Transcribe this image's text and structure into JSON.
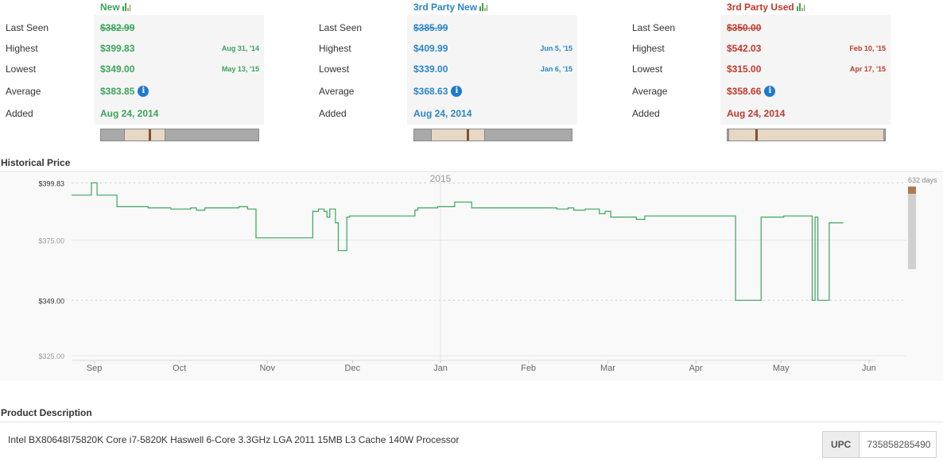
{
  "columns": [
    {
      "key": "new",
      "title": "New",
      "color": "#3aa55a",
      "labels": [
        "Last Seen",
        "Highest",
        "Lowest",
        "Average",
        "Added"
      ],
      "last_seen": "$382.99",
      "highest": "$399.83",
      "highest_date": "Aug 31, '14",
      "lowest": "$349.00",
      "lowest_date": "May 13, '15",
      "average": "$383.85",
      "added": "Aug 24, 2014"
    },
    {
      "key": "third_party_new",
      "title": "3rd Party New",
      "color": "#2c86c6",
      "labels": [
        "Last Seen",
        "Highest",
        "Lowest",
        "Average",
        "Added"
      ],
      "last_seen": "$385.99",
      "highest": "$409.99",
      "highest_date": "Jun 5, '15",
      "lowest": "$339.00",
      "lowest_date": "Jan 6, '15",
      "average": "$368.63",
      "added": "Aug 24, 2014"
    },
    {
      "key": "third_party_used",
      "title": "3rd Party Used",
      "color": "#c0392b",
      "labels": [
        "Last Seen",
        "Highest",
        "Lowest",
        "Average",
        "Added"
      ],
      "last_seen": "$350.00",
      "highest": "$542.03",
      "highest_date": "Feb 10, '15",
      "lowest": "$315.00",
      "lowest_date": "Apr 17, '15",
      "average": "$358.66",
      "added": "Aug 24, 2014"
    }
  ],
  "historical": {
    "title": "Historical Price",
    "year_label": "2015",
    "days_label": "632 days"
  },
  "chart_data": {
    "type": "line",
    "title": "",
    "xlabel": "",
    "ylabel": "",
    "x_ticks": [
      "Sep",
      "Oct",
      "Nov",
      "Dec",
      "Jan",
      "Feb",
      "Mar",
      "Apr",
      "May",
      "Jun"
    ],
    "y_ticks": [
      "$399.83",
      "$375.00",
      "$349.00",
      "$325.00"
    ],
    "y_tick_values": [
      399.83,
      375.0,
      349.0,
      325.0
    ],
    "ylim": [
      323,
      402
    ],
    "x_range": [
      "2014-08-24",
      "2015-06-03"
    ],
    "series": [
      {
        "color": "#3aa55a",
        "step": true,
        "points": [
          [
            "2014-08-24",
            394.5
          ],
          [
            "2014-08-31",
            399.83
          ],
          [
            "2014-09-02",
            394.5
          ],
          [
            "2014-09-09",
            389.5
          ],
          [
            "2014-09-20",
            389.0
          ],
          [
            "2014-09-28",
            388.5
          ],
          [
            "2014-10-05",
            389.0
          ],
          [
            "2014-10-07",
            388.0
          ],
          [
            "2014-10-10",
            389.0
          ],
          [
            "2014-10-13",
            389.0
          ],
          [
            "2014-10-22",
            389.5
          ],
          [
            "2014-10-25",
            388.5
          ],
          [
            "2014-10-28",
            376.0
          ],
          [
            "2014-11-17",
            387.5
          ],
          [
            "2014-11-19",
            388.5
          ],
          [
            "2014-11-21",
            387.5
          ],
          [
            "2014-11-22",
            385.0
          ],
          [
            "2014-11-23",
            388.5
          ],
          [
            "2014-11-25",
            382.5
          ],
          [
            "2014-11-26",
            370.5
          ],
          [
            "2014-11-29",
            385.0
          ],
          [
            "2014-11-30",
            385.5
          ],
          [
            "2014-12-23",
            388.0
          ],
          [
            "2014-12-24",
            389.0
          ],
          [
            "2014-12-31",
            389.5
          ],
          [
            "2015-01-06",
            391.5
          ],
          [
            "2015-01-12",
            389.0
          ],
          [
            "2015-02-11",
            388.5
          ],
          [
            "2015-02-15",
            389.0
          ],
          [
            "2015-02-17",
            388.0
          ],
          [
            "2015-02-21",
            388.5
          ],
          [
            "2015-02-26",
            386.5
          ],
          [
            "2015-02-28",
            387.5
          ],
          [
            "2015-03-02",
            385.0
          ],
          [
            "2015-03-11",
            384.0
          ],
          [
            "2015-03-14",
            385.5
          ],
          [
            "2015-04-15",
            349.0
          ],
          [
            "2015-04-24",
            385.0
          ],
          [
            "2015-05-02",
            385.5
          ],
          [
            "2015-05-12",
            349.0
          ],
          [
            "2015-05-13",
            385.0
          ],
          [
            "2015-05-14",
            349.0
          ],
          [
            "2015-05-18",
            382.5
          ],
          [
            "2015-05-23",
            382.5
          ]
        ]
      }
    ]
  },
  "product": {
    "title": "Product Description",
    "description": "Intel BX80648I75820K Core i7-5820K Haswell 6-Core 3.3GHz LGA 2011 15MB L3 Cache 140W Processor",
    "upc_label": "UPC",
    "upc_value": "735858285490"
  }
}
